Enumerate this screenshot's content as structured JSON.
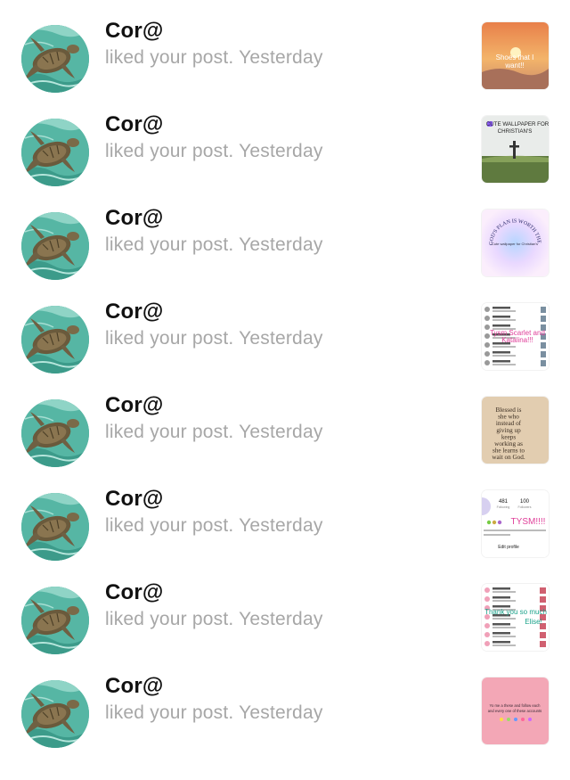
{
  "notifications": [
    {
      "user": "Cor@",
      "action": "liked your post.",
      "time": "Yesterday",
      "thumb": "sunset",
      "thumb_text": "Shoes that I want!!"
    },
    {
      "user": "Cor@",
      "action": "liked your post.",
      "time": "Yesterday",
      "thumb": "cross",
      "thumb_text": "CUTE WALLPAPER FOR CHRISTIAN'S"
    },
    {
      "user": "Cor@",
      "action": "liked your post.",
      "time": "Yesterday",
      "thumb": "gradient",
      "thumb_text": "GOD'S PLAN IS WORTH THE WAIT"
    },
    {
      "user": "Cor@",
      "action": "liked your post.",
      "time": "Yesterday",
      "thumb": "list",
      "thumb_text": "Tysm Scarlet and Katalina!!!"
    },
    {
      "user": "Cor@",
      "action": "liked your post.",
      "time": "Yesterday",
      "thumb": "quote",
      "thumb_text": "Blessed is she who instead of giving up keeps working as she learns to wait on God."
    },
    {
      "user": "Cor@",
      "action": "liked your post.",
      "time": "Yesterday",
      "thumb": "profile",
      "thumb_text": "TYSM!!!!"
    },
    {
      "user": "Cor@",
      "action": "liked your post.",
      "time": "Yesterday",
      "thumb": "thanks",
      "thumb_text": "Thank you so much Elise!"
    },
    {
      "user": "Cor@",
      "action": "liked your post.",
      "time": "Yesterday",
      "thumb": "pink",
      "thumb_text": "Yo me a these and follow each and every one of these accounts"
    }
  ],
  "colors": {
    "name": "#111111",
    "secondary": "#a7a7a7",
    "avatar_bg": "#4fb3a0"
  }
}
